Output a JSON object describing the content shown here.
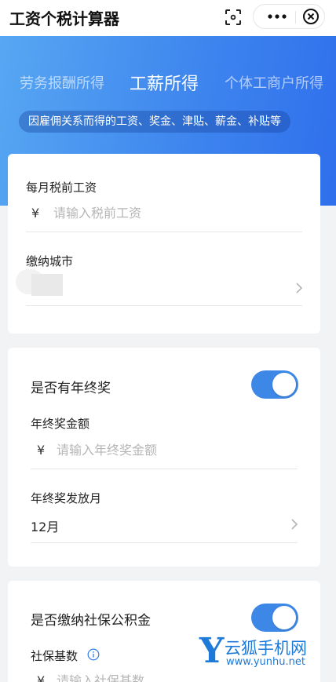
{
  "nav": {
    "title": "工资个税计算器"
  },
  "tabs": [
    {
      "label": "劳务报酬所得"
    },
    {
      "label": "工薪所得"
    },
    {
      "label": "个体工商户所得"
    }
  ],
  "tab_description": "因雇佣关系而得的工资、奖金、津贴、薪金、补贴等",
  "salary_card": {
    "salary_label": "每月税前工资",
    "currency": "¥",
    "salary_placeholder": "请输入税前工资",
    "city_label": "缴纳城市",
    "city_value": ""
  },
  "bonus_card": {
    "toggle_label": "是否有年终奖",
    "toggle_on": true,
    "amount_label": "年终奖金额",
    "currency": "¥",
    "amount_placeholder": "请输入年终奖金额",
    "month_label": "年终奖发放月",
    "month_value": "12月"
  },
  "insurance_card": {
    "toggle_label": "是否缴纳社保公积金",
    "toggle_on": true,
    "base_label": "社保基数",
    "currency": "¥",
    "base_placeholder": "请输入社保基数"
  },
  "watermark": {
    "logo_letter": "Y",
    "name": "云狐手机网",
    "url": "www.yunhu.net"
  },
  "colors": {
    "accent": "#3d87e6",
    "header_gradient_start": "#57a7f3",
    "header_gradient_end": "#2f6fec"
  }
}
